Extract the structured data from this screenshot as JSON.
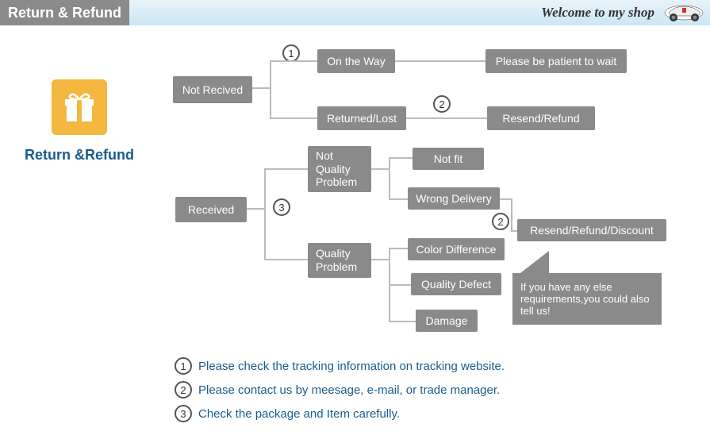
{
  "header": {
    "title": "Return & Refund",
    "welcome": "Welcome to my shop"
  },
  "sidebar": {
    "title": "Return &Refund"
  },
  "nodes": {
    "not_received": "Not Recived",
    "received": "Received",
    "on_the_way": "On the Way",
    "returned_lost": "Returned/Lost",
    "not_quality_problem": "Not Quality Problem",
    "quality_problem": "Quality Problem",
    "not_fit": "Not fit",
    "wrong_delivery": "Wrong Delivery",
    "color_difference": "Color Difference",
    "quality_defect": "Quality Defect",
    "damage": "Damage",
    "please_wait": "Please be patient to wait",
    "resend_refund": "Resend/Refund",
    "resend_refund_discount": "Resend/Refund/Discount"
  },
  "speech": {
    "text": "If you have any else requirements,you could also tell us!"
  },
  "steps": {
    "s1": "1",
    "s2": "2",
    "s3": "3"
  },
  "notes": {
    "n1": "Please check the tracking information on tracking website.",
    "n2": "Please contact us by meesage, e-mail, or trade manager.",
    "n3": "Check the package and Item carefully."
  }
}
